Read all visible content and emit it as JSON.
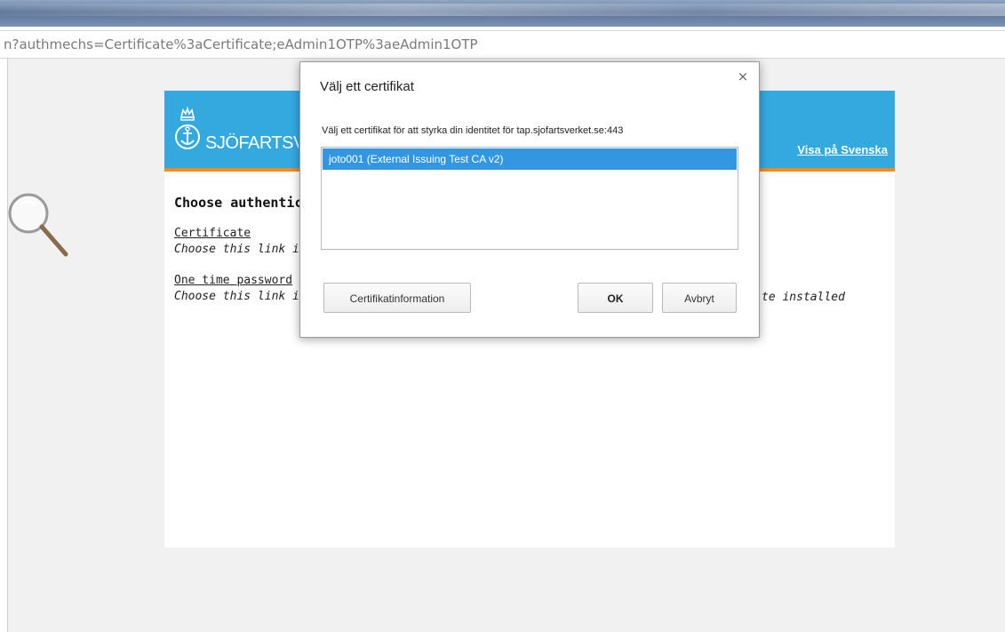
{
  "browser": {
    "address_text": "n?authmechs=Certificate%3aCertificate;eAdmin1OTP%3aeAdmin1OTP"
  },
  "site": {
    "logo_text": "SJÖFARTSVERKET",
    "language_link": "Visa på Svenska",
    "heading": "Choose authentication method",
    "options": [
      {
        "link": "Certificate",
        "description": "Choose this link if you have a certificate installed"
      },
      {
        "link": "One time password",
        "description": "Choose this link if you do not have a certificate installed",
        "description_visible_tail": "te installed"
      }
    ],
    "colors": {
      "header": "#34a9e0",
      "header_border": "#f28a1c"
    }
  },
  "dialog": {
    "title": "Välj ett certifikat",
    "close_icon": "close-icon",
    "description": "Välj ett certifikat för att styrka din identitet för tap.sjofartsverket.se:443",
    "certificates": [
      {
        "label": "joto001 (External Issuing Test CA v2)",
        "selected": true
      }
    ],
    "buttons": {
      "info": "Certifikatinformation",
      "ok": "OK",
      "cancel": "Avbryt"
    },
    "colors": {
      "selection": "#3296e0"
    }
  }
}
